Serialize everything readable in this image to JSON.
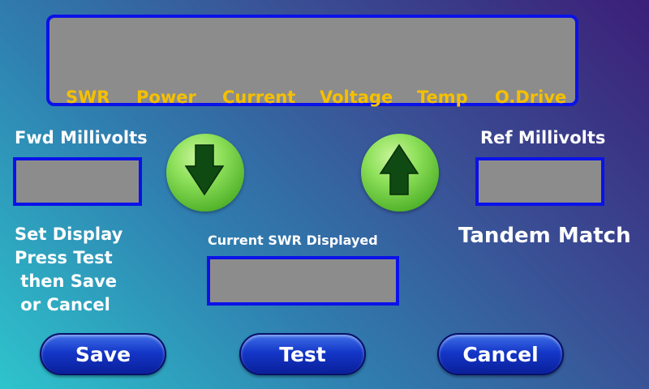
{
  "meter_labels": [
    "SWR",
    "Power",
    "Current",
    "Voltage",
    "Temp",
    "O.Drive"
  ],
  "fwd": {
    "label": "Fwd Millivolts",
    "value": ""
  },
  "ref": {
    "label": "Ref Millivolts",
    "value": ""
  },
  "current_swr": {
    "label": "Current SWR Displayed",
    "value": ""
  },
  "mode_title": "Tandem Match",
  "instructions": [
    "Set Display",
    "Press Test",
    " then Save",
    " or Cancel"
  ],
  "buttons": {
    "save": "Save",
    "test": "Test",
    "cancel": "Cancel"
  },
  "icons": {
    "decrease": "arrow-down-icon",
    "increase": "arrow-up-icon"
  },
  "colors": {
    "meter_label": "#f5c000",
    "box_border": "#0a12e8",
    "box_fill": "#8c8c8c",
    "arrow_button": "#6cc93a",
    "pill_button": "#1437c8"
  }
}
